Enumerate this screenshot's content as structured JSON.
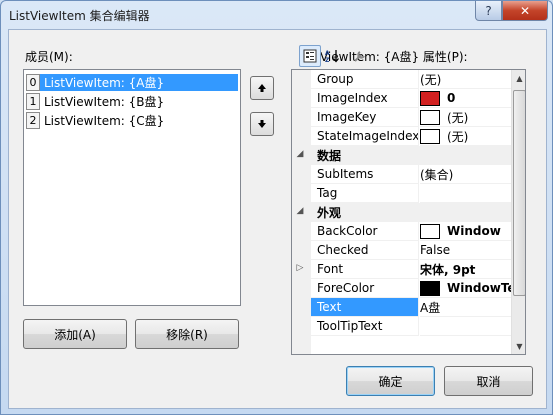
{
  "window": {
    "title": "ListViewItem 集合编辑器",
    "help_label": "?",
    "close_label": "✕"
  },
  "members": {
    "label": "成员(M):",
    "items": [
      {
        "index": "0",
        "text": "ListViewItem: {A盘}",
        "selected": true
      },
      {
        "index": "1",
        "text": "ListViewItem: {B盘}",
        "selected": false
      },
      {
        "index": "2",
        "text": "ListViewItem: {C盘}",
        "selected": false
      }
    ],
    "move_up_icon": "arrow-up-icon",
    "move_down_icon": "arrow-down-icon",
    "add_label": "添加(A)",
    "remove_label": "移除(R)"
  },
  "properties": {
    "label": "ListViewItem: {A盘} 属性(P):",
    "toolbar_icons": [
      "categorized-icon",
      "alphabetical-icon",
      "property-pages-icon"
    ],
    "rows": [
      {
        "type": "prop",
        "name": "Group",
        "value": "(无)"
      },
      {
        "type": "prop",
        "name": "ImageIndex",
        "value": "0",
        "swatch": "#d22020",
        "bold": true
      },
      {
        "type": "prop",
        "name": "ImageKey",
        "value": "(无)",
        "swatch": "#ffffff"
      },
      {
        "type": "prop",
        "name": "StateImageIndex",
        "value": "(无)",
        "swatch": "#ffffff"
      },
      {
        "type": "cat",
        "name": "数据"
      },
      {
        "type": "prop",
        "name": "SubItems",
        "value": "(集合)"
      },
      {
        "type": "prop",
        "name": "Tag",
        "value": ""
      },
      {
        "type": "cat",
        "name": "外观"
      },
      {
        "type": "prop",
        "name": "BackColor",
        "value": "Window",
        "swatch": "#ffffff",
        "bold": true
      },
      {
        "type": "prop",
        "name": "Checked",
        "value": "False"
      },
      {
        "type": "prop",
        "name": "Font",
        "value": "宋体, 9pt",
        "bold": true,
        "expandable": true
      },
      {
        "type": "prop",
        "name": "ForeColor",
        "value": "WindowText",
        "swatch": "#000000",
        "bold": true
      },
      {
        "type": "prop",
        "name": "Text",
        "value": "A盘",
        "selected": true
      },
      {
        "type": "prop",
        "name": "ToolTipText",
        "value": ""
      }
    ]
  },
  "footer": {
    "ok_label": "确定",
    "cancel_label": "取消"
  }
}
